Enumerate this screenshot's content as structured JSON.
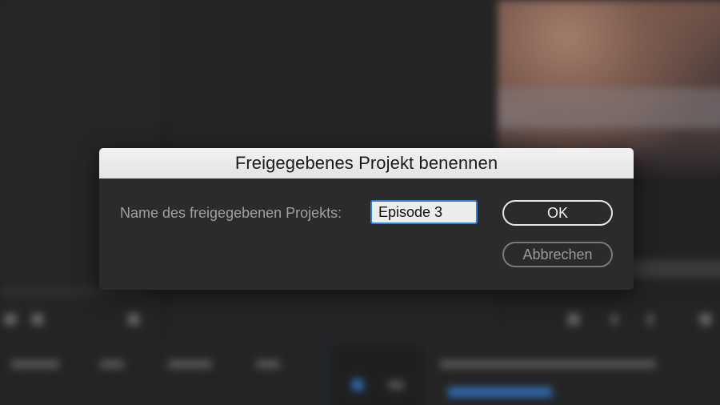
{
  "dialog": {
    "title": "Freigegebenes Projekt benennen",
    "field_label": "Name des freigegebenen Projekts:",
    "name_value": "Episode 3",
    "ok_label": "OK",
    "cancel_label": "Abbrechen"
  },
  "colors": {
    "title_bar": "#e9e8e9",
    "dialog_body": "#2b2b2b",
    "input_focus_border": "#2f7fd6",
    "primary_button_border": "#e6e6e6",
    "secondary_button_border": "#7a7a7a"
  }
}
